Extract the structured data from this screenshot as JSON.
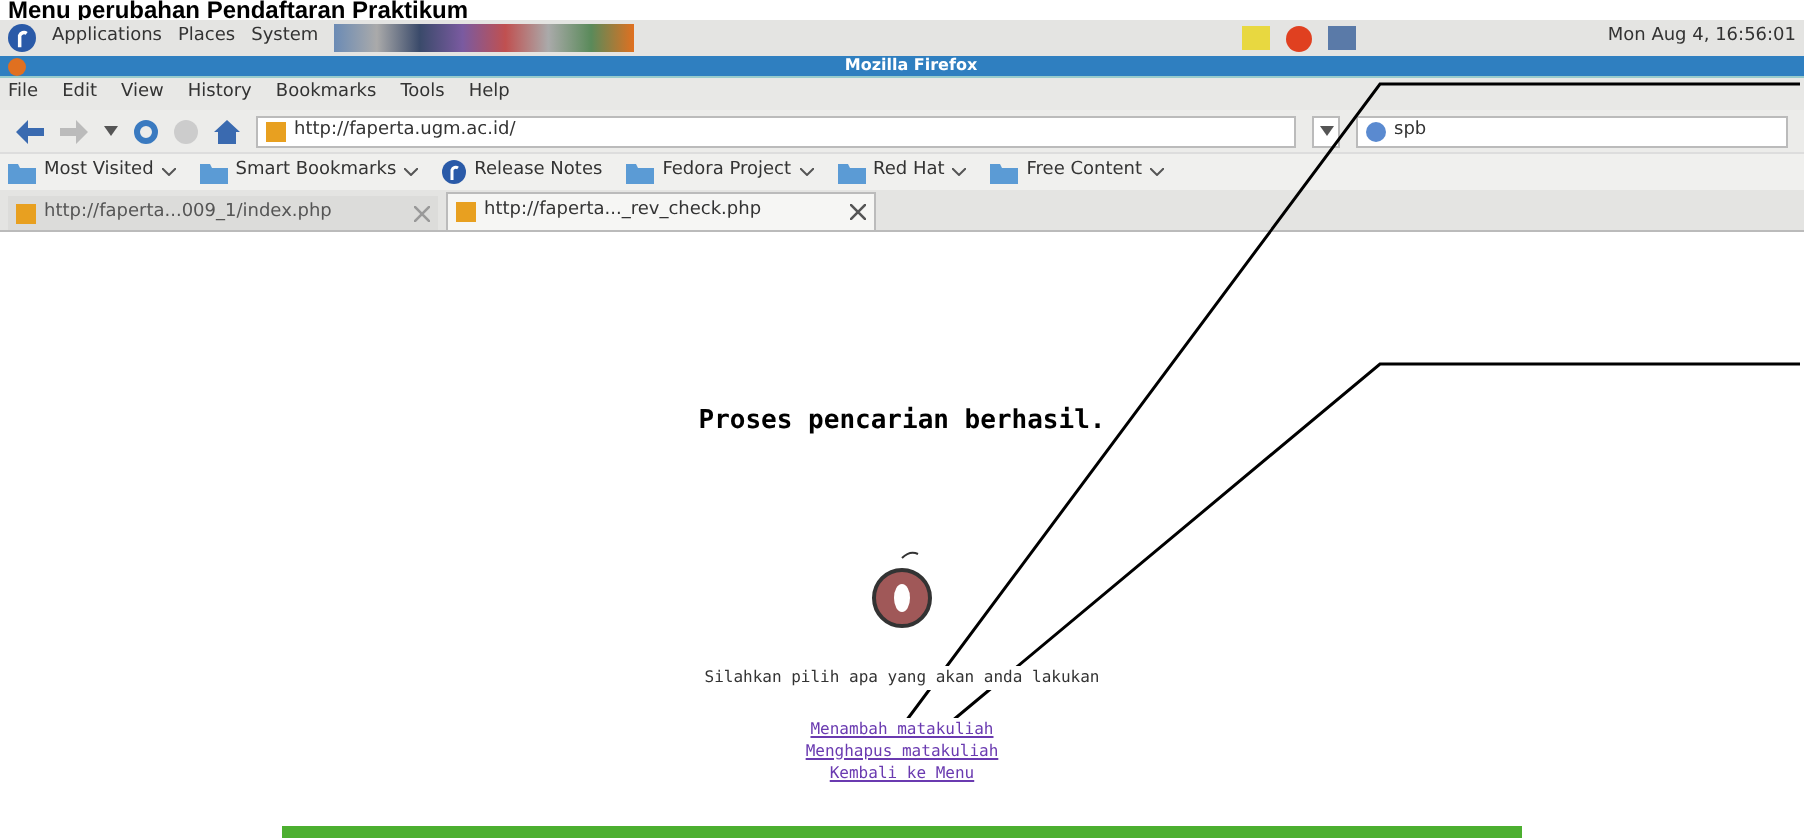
{
  "caption": "Menu perubahan Pendaftaran Praktikum",
  "top_panel": {
    "menus": [
      "Applications",
      "Places",
      "System"
    ],
    "clock": "Mon Aug 4, 16:56:01"
  },
  "window": {
    "title": "Mozilla Firefox"
  },
  "menu_bar": [
    "File",
    "Edit",
    "View",
    "History",
    "Bookmarks",
    "Tools",
    "Help"
  ],
  "nav": {
    "url": "http://faperta.ugm.ac.id/",
    "search": "spb"
  },
  "bookmarks": [
    {
      "label": "Most Visited",
      "kind": "folder",
      "dropdown": true
    },
    {
      "label": "Smart Bookmarks",
      "kind": "folder",
      "dropdown": true
    },
    {
      "label": "Release Notes",
      "kind": "fedora",
      "dropdown": false
    },
    {
      "label": "Fedora Project",
      "kind": "folder",
      "dropdown": true
    },
    {
      "label": "Red Hat",
      "kind": "folder",
      "dropdown": true
    },
    {
      "label": "Free Content",
      "kind": "folder",
      "dropdown": true
    }
  ],
  "tabs": [
    {
      "label": "http://faperta...009_1/index.php",
      "selected": false
    },
    {
      "label": "http://faperta..._rev_check.php",
      "selected": true
    }
  ],
  "page": {
    "heading": "Proses pencarian berhasil.",
    "prompt": "Silahkan pilih apa yang akan anda lakukan",
    "links": [
      "Menambah matakuliah",
      "Menghapus matakuliah",
      "Kembali ke Menu"
    ]
  }
}
